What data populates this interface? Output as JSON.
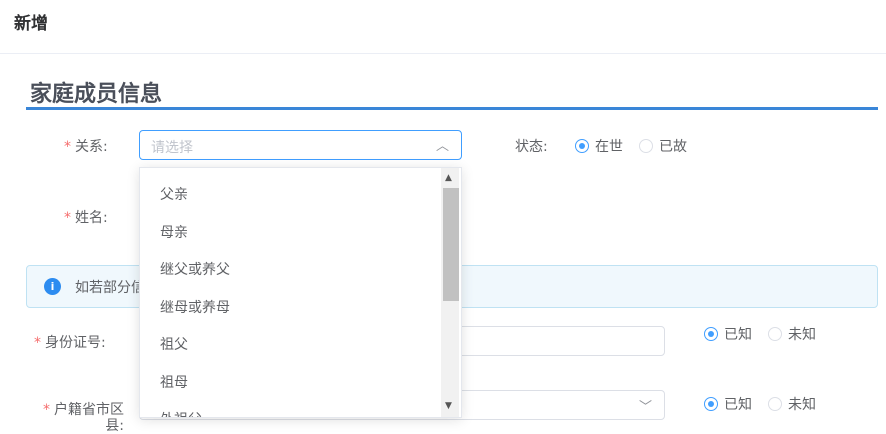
{
  "header": {
    "title": "新增"
  },
  "section": {
    "title": "家庭成员信息"
  },
  "relation": {
    "label": "关系:",
    "placeholder": "请选择"
  },
  "status": {
    "label": "状态:",
    "options": [
      "在世",
      "已故"
    ],
    "selected": "在世"
  },
  "name": {
    "label": "姓名:"
  },
  "alert": {
    "text": "如若部分信"
  },
  "id_number": {
    "label": "身份证号:",
    "options": [
      "已知",
      "未知"
    ],
    "selected": "已知"
  },
  "hukou": {
    "label": "户籍省市区县:",
    "options": [
      "已知",
      "未知"
    ],
    "selected": "已知"
  },
  "dropdown": {
    "items": [
      "父亲",
      "母亲",
      "继父或养父",
      "继母或养母",
      "祖父",
      "祖母",
      "外祖父"
    ],
    "scroll_position": 0
  }
}
